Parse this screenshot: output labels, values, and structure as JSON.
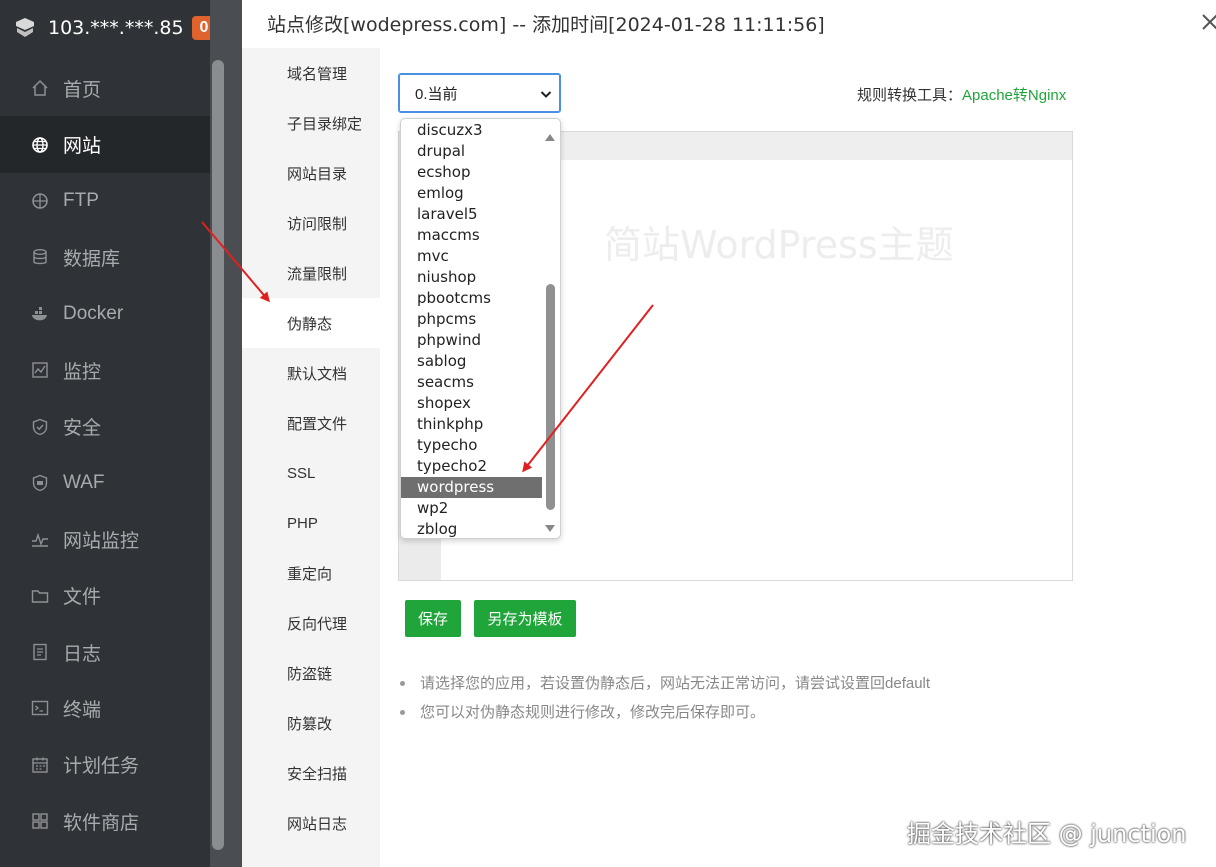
{
  "server": {
    "ip": "103.***.***.85",
    "badge": "0"
  },
  "sidebar": {
    "items": [
      {
        "label": "首页",
        "icon": "home-icon"
      },
      {
        "label": "网站",
        "icon": "globe-icon"
      },
      {
        "label": "FTP",
        "icon": "ftp-icon"
      },
      {
        "label": "数据库",
        "icon": "database-icon"
      },
      {
        "label": "Docker",
        "icon": "docker-icon"
      },
      {
        "label": "监控",
        "icon": "monitor-icon"
      },
      {
        "label": "安全",
        "icon": "shield-icon"
      },
      {
        "label": "WAF",
        "icon": "waf-icon"
      },
      {
        "label": "网站监控",
        "icon": "site-monitor-icon"
      },
      {
        "label": "文件",
        "icon": "folder-icon"
      },
      {
        "label": "日志",
        "icon": "log-icon"
      },
      {
        "label": "终端",
        "icon": "terminal-icon"
      },
      {
        "label": "计划任务",
        "icon": "calendar-icon"
      },
      {
        "label": "软件商店",
        "icon": "store-icon"
      }
    ],
    "active_index": 1
  },
  "dialog": {
    "title": "站点修改[wodepress.com] -- 添加时间[2024-01-28 11:11:56]",
    "tabs": [
      "域名管理",
      "子目录绑定",
      "网站目录",
      "访问限制",
      "流量限制",
      "伪静态",
      "默认文档",
      "配置文件",
      "SSL",
      "PHP",
      "重定向",
      "反向代理",
      "防盗链",
      "防篡改",
      "安全扫描",
      "网站日志"
    ],
    "active_tab": "伪静态"
  },
  "rewrite": {
    "selected": "0.当前",
    "tool_label": "规则转换工具：",
    "tool_link": "Apache转Nginx",
    "editor_watermark": "简站WordPress主题",
    "options": [
      "discuzx3",
      "drupal",
      "ecshop",
      "emlog",
      "laravel5",
      "maccms",
      "mvc",
      "niushop",
      "pbootcms",
      "phpcms",
      "phpwind",
      "sablog",
      "seacms",
      "shopex",
      "thinkphp",
      "typecho",
      "typecho2",
      "wordpress",
      "wp2",
      "zblog"
    ],
    "highlighted_option": "wordpress",
    "save_label": "保存",
    "template_label": "另存为模板",
    "tips": [
      "请选择您的应用，若设置伪静态后，网站无法正常访问，请尝试设置回default",
      "您可以对伪静态规则进行修改，修改完后保存即可。"
    ]
  },
  "brand_watermark": "掘金技术社区 @ junction",
  "colors": {
    "accent": "#20a53a",
    "sidebar_bg": "#2f3337",
    "badge": "#e0622d",
    "arrow": "#e02020"
  }
}
